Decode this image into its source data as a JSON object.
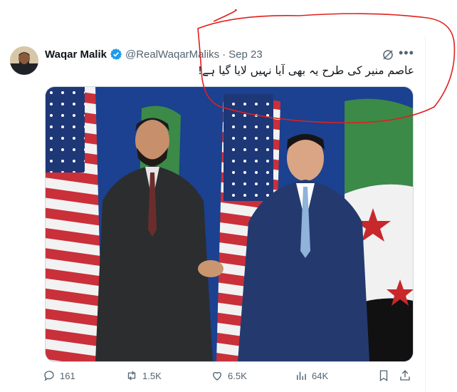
{
  "tweet": {
    "author_name": "Waqar Malik",
    "handle": "@RealWaqarMaliks",
    "separator": "·",
    "date": "Sep 23",
    "text": "عاصم منیر کی طرح یہ بھی آیا نہیں لایا گیا ہے!"
  },
  "metrics": {
    "replies": "161",
    "reposts": "1.5K",
    "likes": "6.5K",
    "views": "64K"
  },
  "icons": {
    "verified": "verified-badge-icon",
    "grok": "grok-icon",
    "more": "more-options-icon",
    "reply": "reply-icon",
    "repost": "repost-icon",
    "like": "like-icon",
    "views": "views-icon",
    "bookmark": "bookmark-icon",
    "share": "share-icon"
  },
  "colors": {
    "verified_blue": "#1d9bf0",
    "secondary_text": "#536471",
    "annotation_red": "#e0201e"
  }
}
